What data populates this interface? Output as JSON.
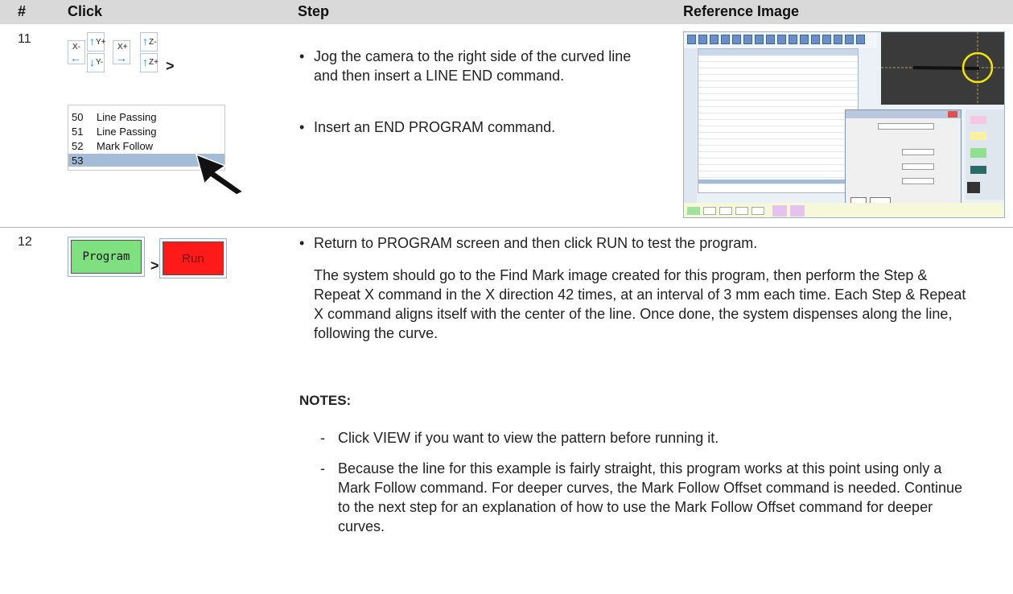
{
  "header": {
    "col_num": "#",
    "col_click": "Click",
    "col_step": "Step",
    "col_ref": "Reference Image"
  },
  "rows": [
    {
      "num": "11",
      "jog_buttons": [
        {
          "label": "X-",
          "icon": "arrow-left-icon"
        },
        {
          "label": "Y+",
          "icon": "arrow-up-icon"
        },
        {
          "label": "Y-",
          "icon": "arrow-down-icon"
        },
        {
          "label": "X+",
          "icon": "arrow-right-icon"
        },
        {
          "label": "Z-",
          "icon": "arrow-up-icon"
        },
        {
          "label": "Z+",
          "icon": "arrow-up-icon"
        }
      ],
      "then_symbol": ">",
      "list": [
        {
          "n": "50",
          "label": "Line Passing"
        },
        {
          "n": "51",
          "label": "Line Passing"
        },
        {
          "n": "52",
          "label": "Mark Follow"
        },
        {
          "n": "53",
          "label": ""
        }
      ],
      "steps": [
        "Jog the camera to the right side of the curved line and then insert a LINE END command.",
        "Insert an END PROGRAM command."
      ]
    },
    {
      "num": "12",
      "program_label": "Program",
      "run_label": "Run",
      "then_symbol": ">",
      "step": "Return to PROGRAM screen and then click RUN to test the program.",
      "description": "The system should go to the Find Mark image created for this program, then perform the Step & Repeat X command in the X direction 42 times, at an interval of 3 mm each time. Each Step & Repeat X command aligns itself with the center of the line. Once done, the system dispenses along the line, following the curve.",
      "notes_heading": "NOTES:",
      "notes": [
        "Click VIEW if you want to view the pattern before running it.",
        "Because the line for this example is fairly straight, this program works at this point using only a Mark Follow command. For deeper curves, the Mark Follow Offset command is needed. Continue to the next step for an explanation of how to use the Mark Follow Offset command for deeper curves."
      ]
    }
  ],
  "colors": {
    "header_bg": "#d9d9d9",
    "program_green": "#7fe07f",
    "run_red": "#ff1a1a",
    "selected_row": "#a5bcd8",
    "arrow_blue": "#2a8ad6"
  }
}
